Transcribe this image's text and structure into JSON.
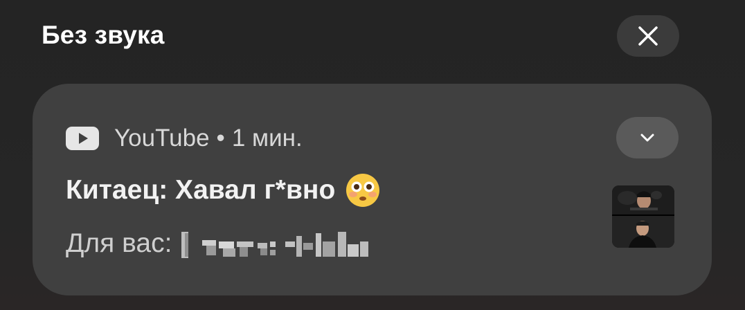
{
  "section": {
    "title": "Без звука"
  },
  "notification": {
    "app_name": "YouTube",
    "separator": "•",
    "time": "1 мин.",
    "title": "Китаец: Хавал г*вно",
    "title_emoji": "flushed-face-emoji",
    "body_prefix": "Для вас:",
    "body_redacted": true,
    "thumbnail": "video-thumbnail"
  },
  "icons": {
    "close": "close-icon",
    "expand": "chevron-down-icon",
    "app": "youtube-icon"
  },
  "colors": {
    "background": "#262626",
    "card": "#404040",
    "button": "#3b3b3b",
    "expand_button": "#5a5a5a",
    "text_primary": "#ffffff",
    "text_secondary": "#d8d8d8"
  }
}
